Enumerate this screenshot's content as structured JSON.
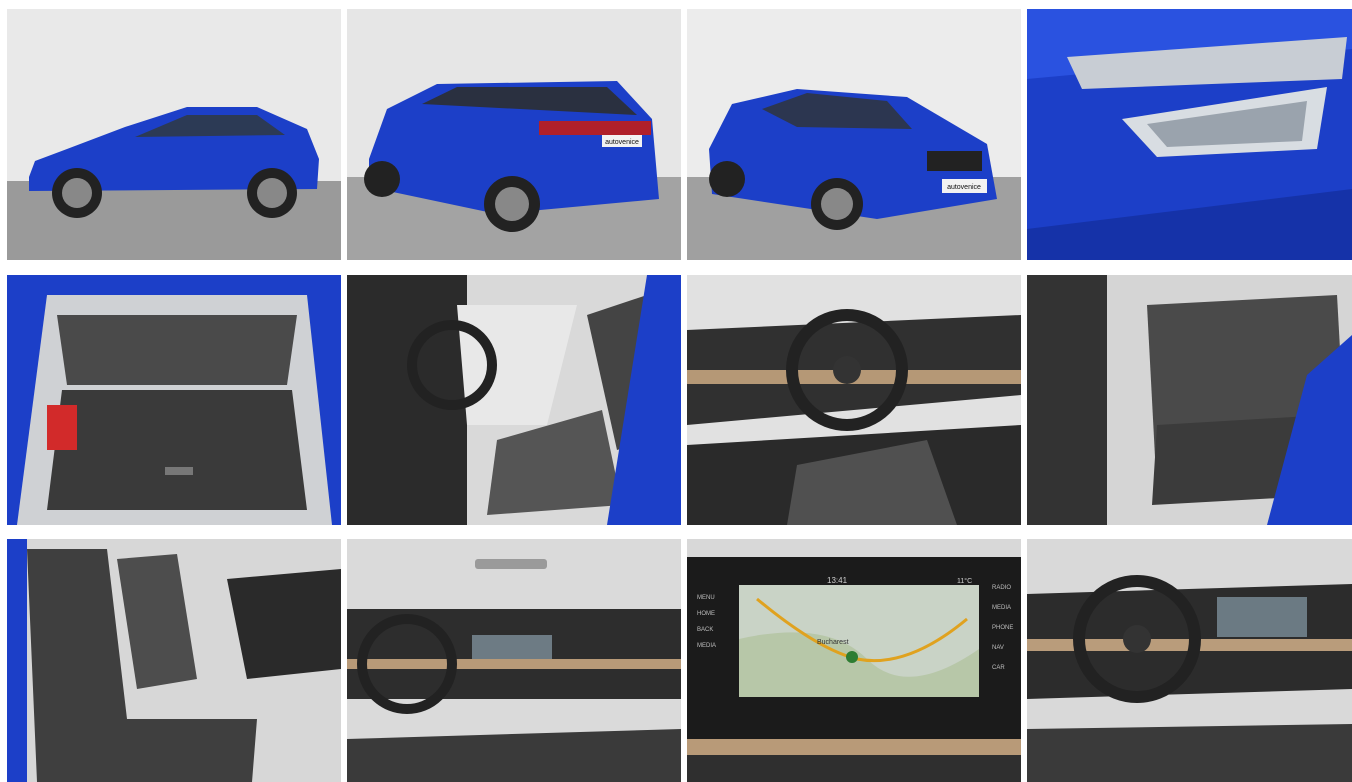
{
  "gallery": {
    "photos": [
      {
        "name": "exterior-side-view"
      },
      {
        "name": "exterior-rear-three-quarter"
      },
      {
        "name": "exterior-front-three-quarter"
      },
      {
        "name": "headlight-detail"
      },
      {
        "name": "trunk-open"
      },
      {
        "name": "driver-seat-interior"
      },
      {
        "name": "steering-wheel-interior"
      },
      {
        "name": "rear-seats"
      },
      {
        "name": "front-seats-side"
      },
      {
        "name": "dashboard-overview"
      },
      {
        "name": "infotainment-navigation"
      },
      {
        "name": "cockpit-view"
      }
    ],
    "plate_text": "autovenice",
    "nav_screen": {
      "time": "13:41",
      "temp": "11°C",
      "place": "Bucharest",
      "left_menu": [
        "MENU",
        "HOME",
        "BACK",
        "MEDIA",
        ""
      ],
      "right_menu": [
        "RADIO",
        "MEDIA",
        "PHONE",
        "NAV",
        "CAR"
      ]
    }
  },
  "colors": {
    "car_blue": "#1c3fc8",
    "background": "#ffffff"
  }
}
